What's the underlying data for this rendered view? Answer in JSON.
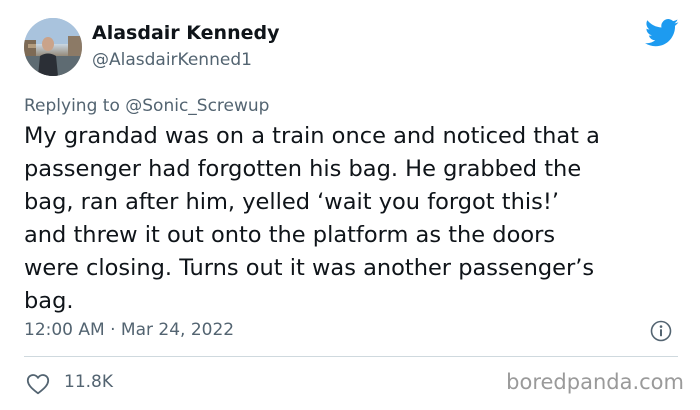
{
  "author": {
    "display_name": "Alasdair Kennedy",
    "handle": "@AlasdairKenned1"
  },
  "reply": {
    "prefix": "Replying to ",
    "mention": "@Sonic_Screwup"
  },
  "tweet": {
    "lines": [
      "My grandad was on a train once and noticed that a",
      "passenger had forgotten his bag. He grabbed the",
      "bag, ran after him, yelled ‘wait you forgot this!’",
      "and threw it out onto the platform as the doors",
      "were closing. Turns out it was another passenger’s",
      "bag."
    ],
    "timestamp": "12:00 AM · Mar 24, 2022"
  },
  "engagement": {
    "likes": "11.8K"
  },
  "watermark": "boredpanda.com",
  "icons": {
    "brand": "twitter-bird-icon",
    "info": "info-icon",
    "like": "heart-icon"
  },
  "colors": {
    "text": "#0f1419",
    "secondary": "#536471",
    "twitter_blue": "#1d9bf0",
    "divider": "#cfd9de"
  }
}
